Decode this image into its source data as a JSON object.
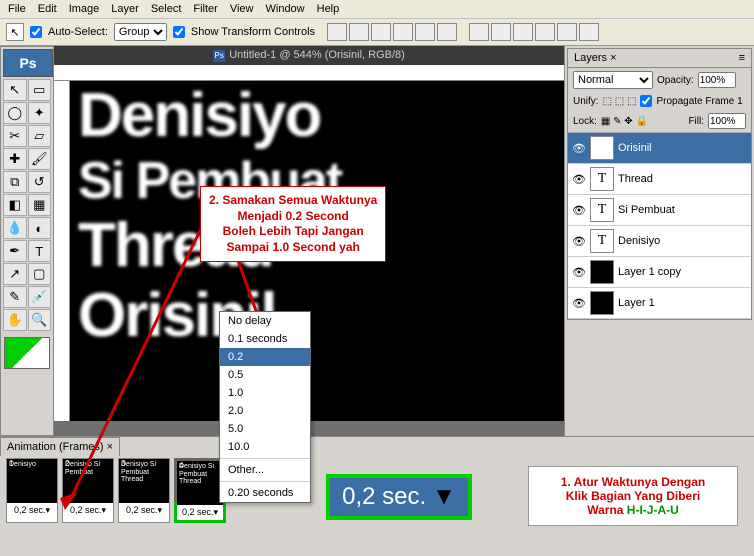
{
  "menu": [
    "File",
    "Edit",
    "Image",
    "Layer",
    "Select",
    "Filter",
    "View",
    "Window",
    "Help"
  ],
  "opt": {
    "autoselect": "Auto-Select:",
    "group": "Group",
    "transform": "Show Transform Controls"
  },
  "doc": {
    "title": "Untitled-1 @ 544% (Orisinil, RGB/8)"
  },
  "canvas": {
    "line1": "Denisiyo",
    "line2": "Si Pembuat",
    "line3": "Thread",
    "line4": "Orisinil"
  },
  "callout2": {
    "l1": "2. Samakan Semua Waktunya",
    "l2": "Menjadi 0.2 Second",
    "l3": "Boleh Lebih Tapi Jangan",
    "l4": "Sampai 1.0 Second yah"
  },
  "delaymenu": {
    "i0": "No delay",
    "i1": "0.1 seconds",
    "i2": "0.2",
    "i3": "0.5",
    "i4": "1.0",
    "i5": "2.0",
    "i6": "5.0",
    "i7": "10.0",
    "i8": "Other...",
    "i9": "0.20 seconds"
  },
  "layerspanel": {
    "tab": "Layers",
    "blend": "Normal",
    "opacity_lbl": "Opacity:",
    "opacity_val": "100%",
    "unify": "Unify:",
    "propagate": "Propagate Frame 1",
    "lock": "Lock:",
    "fill_lbl": "Fill:",
    "fill_val": "100%",
    "items": [
      {
        "name": "Orisinil",
        "type": "T",
        "sel": true
      },
      {
        "name": "Thread",
        "type": "T",
        "sel": false
      },
      {
        "name": "Si Pembuat",
        "type": "T",
        "sel": false
      },
      {
        "name": "Denisiyo",
        "type": "T",
        "sel": false
      },
      {
        "name": "Layer 1 copy",
        "type": "solid",
        "sel": false
      },
      {
        "name": "Layer 1",
        "type": "solid",
        "sel": false
      }
    ]
  },
  "anim": {
    "tab": "Animation (Frames)",
    "frames": [
      {
        "n": "1",
        "txt": "Denisiyo",
        "d": "0,2 sec."
      },
      {
        "n": "2",
        "txt": "Denisiyo Si Pembuat",
        "d": "0,2 sec."
      },
      {
        "n": "3",
        "txt": "Denisiyo Si Pembuat Thread",
        "d": "0,2 sec."
      },
      {
        "n": "4",
        "txt": "Denisiyo Si Pembuat Thread",
        "d": "0,2 sec."
      }
    ]
  },
  "zoom": "0,2 sec.",
  "warn": {
    "l1": "1. Atur Waktunya Dengan",
    "l2": "Klik Bagian Yang Diberi",
    "l3": "Warna ",
    "grn": "H-I-J-A-U"
  }
}
